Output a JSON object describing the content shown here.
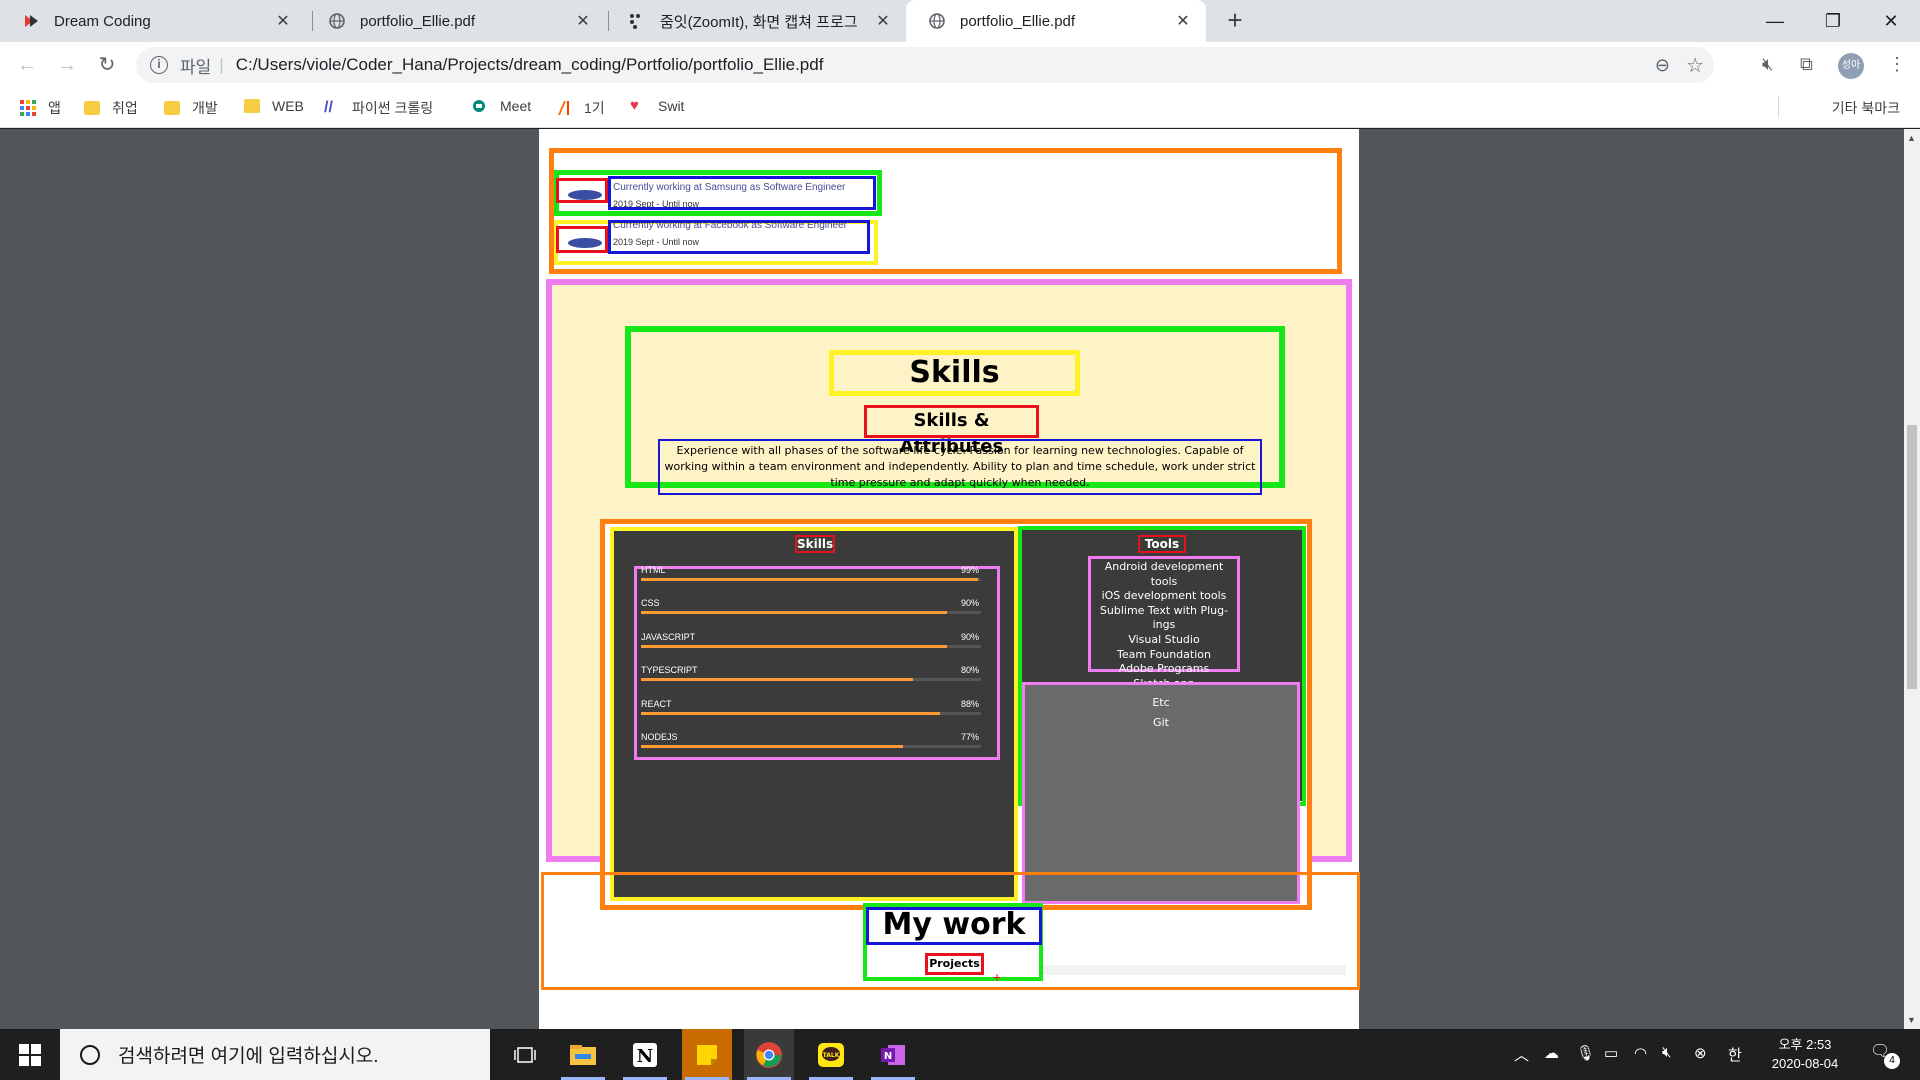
{
  "browser": {
    "tabs": [
      {
        "title": "Dream Coding",
        "icon": "dream-coding-icon"
      },
      {
        "title": "portfolio_Ellie.pdf",
        "icon": "globe-icon"
      },
      {
        "title": "줌잇(ZoomIt), 화면 캡쳐 프로그",
        "icon": "zoomit-icon"
      },
      {
        "title": "portfolio_Ellie.pdf",
        "icon": "globe-icon",
        "active": true
      }
    ],
    "address": {
      "scheme": "파일",
      "url": "C:/Users/viole/Coder_Hana/Projects/dream_coding/Portfolio/portfolio_Ellie.pdf"
    },
    "profile": "성아",
    "bookmarks": [
      "앱",
      "취업",
      "개발",
      "WEB",
      "파이썬 크롤링",
      "Meet",
      "1기",
      "Swit"
    ],
    "other_bookmarks": "기타 북마크"
  },
  "pdf": {
    "jobs": [
      {
        "title": "Currently working at Samsung as Software Engineer",
        "period": "2019 Sept - Until now",
        "logo": "samsung-logo"
      },
      {
        "title": "Currently working at Facebook as Software Engineer",
        "period": "2019 Sept - Until now",
        "logo": "samsung-logo"
      }
    ],
    "skills_section": {
      "title": "Skills",
      "subtitle": "Skills & Attributes",
      "description": "Experience with all phases of the software life-cycle. Passion for learning new technologies. Capable of working within a team environment and independently. Ability to plan and time schedule, work under strict time pressure and adapt quickly when needed.",
      "skills_title": "Skills",
      "skills": [
        {
          "name": "HTML",
          "percent": "99%",
          "level": 0.99
        },
        {
          "name": "CSS",
          "percent": "90%",
          "level": 0.9
        },
        {
          "name": "JAVASCRIPT",
          "percent": "90%",
          "level": 0.9
        },
        {
          "name": "TYPESCRIPT",
          "percent": "80%",
          "level": 0.8
        },
        {
          "name": "REACT",
          "percent": "88%",
          "level": 0.88
        },
        {
          "name": "NODEJS",
          "percent": "77%",
          "level": 0.77
        }
      ],
      "tools_title": "Tools",
      "tools": [
        "Android development tools",
        "iOS development tools",
        "Sublime Text with Plug-ings",
        "Visual Studio",
        "Team Foundation",
        "Adobe Programs",
        "Sketch app"
      ],
      "etc_title": "Etc",
      "etc": [
        "Git"
      ]
    },
    "mywork": {
      "title": "My work",
      "projects": "Projects"
    }
  },
  "taskbar": {
    "search_placeholder": "검색하려면 여기에 입력하십시오.",
    "ampm_time": "오후 2:53",
    "date": "2020-08-04",
    "ime": "한",
    "notifications": "4"
  },
  "colors": {
    "orange": "#ff7f0f",
    "green": "#17e617",
    "red": "#e8101c",
    "blue": "#1616d6",
    "yellow": "#fff224",
    "pink": "#ef7cf0",
    "skills_bg": "#fef3c7",
    "skill_bar": "#ff9933"
  }
}
